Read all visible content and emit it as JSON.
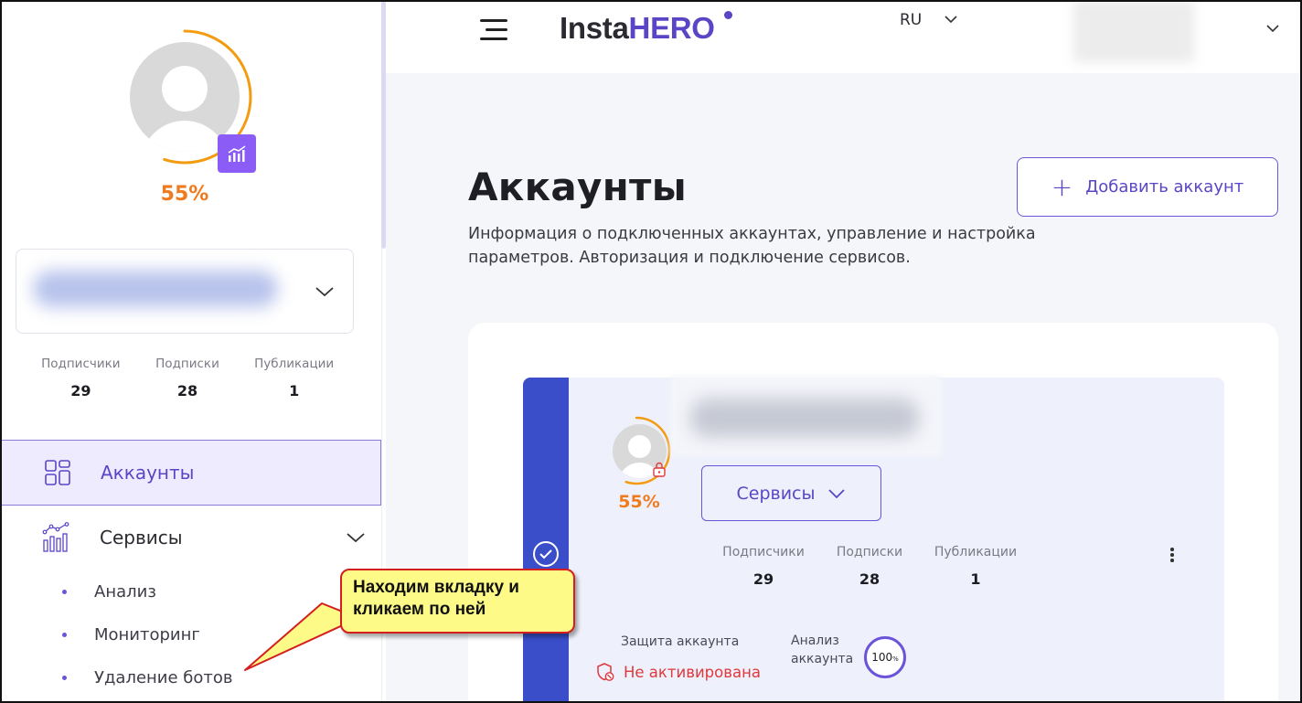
{
  "header": {
    "logo_part1": "Insta",
    "logo_part2": "HERO",
    "language": "RU"
  },
  "sidebar": {
    "progress_percent": "55%",
    "progress_fraction": 0.55,
    "stats": [
      {
        "label": "Подписчики",
        "value": "29"
      },
      {
        "label": "Подписки",
        "value": "28"
      },
      {
        "label": "Публикации",
        "value": "1"
      }
    ],
    "nav": {
      "accounts": "Аккаунты",
      "services": "Сервисы",
      "sub_items": [
        "Анализ",
        "Мониторинг",
        "Удаление ботов"
      ]
    }
  },
  "main": {
    "title": "Аккаунты",
    "description": "Информация о подключенных аккаунтах, управление и настройка параметров. Авторизация и подключение сервисов.",
    "add_button": "Добавить аккаунт",
    "add_plus": "+",
    "card": {
      "progress_percent": "55%",
      "services_button": "Сервисы",
      "stats": [
        {
          "label": "Подписчики",
          "value": "29"
        },
        {
          "label": "Подписки",
          "value": "28"
        },
        {
          "label": "Публикации",
          "value": "1"
        }
      ],
      "protection_label": "Защита аккаунта",
      "protection_status": "Не активирована",
      "analysis_label_1": "Анализ",
      "analysis_label_2": "аккаунта",
      "analysis_value": "100",
      "analysis_unit": "%"
    }
  },
  "callout": {
    "text": "Находим вкладку и кликаем по ней"
  },
  "colors": {
    "accent": "#5b45c7",
    "progress": "#f07b1e",
    "strip": "#3a4ec9",
    "danger": "#e0383b"
  }
}
